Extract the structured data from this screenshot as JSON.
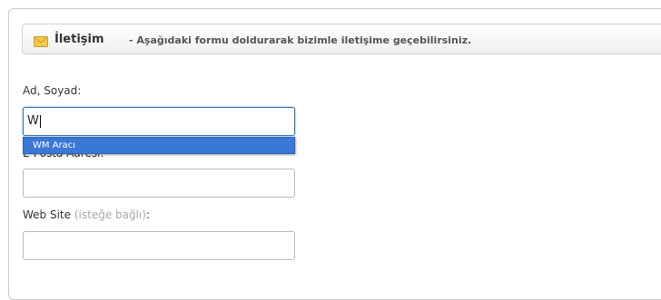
{
  "header": {
    "title": "İletişim",
    "subtitle": "- Aşağıdaki formu doldurarak bizimle iletişime geçebilirsiniz.",
    "icon": "envelope-icon"
  },
  "form": {
    "name": {
      "label": "Ad, Soyad:",
      "value": "W"
    },
    "autocomplete": {
      "suggestion": "WM Aracı"
    },
    "email": {
      "label": "E-Posta Adresi:",
      "value": ""
    },
    "website": {
      "label": "Web Site",
      "optional": "(isteğe bağlı)",
      "colon": ":",
      "value": ""
    }
  },
  "colors": {
    "accent": "#3a78d6",
    "focus_border": "#3a6fb0"
  }
}
